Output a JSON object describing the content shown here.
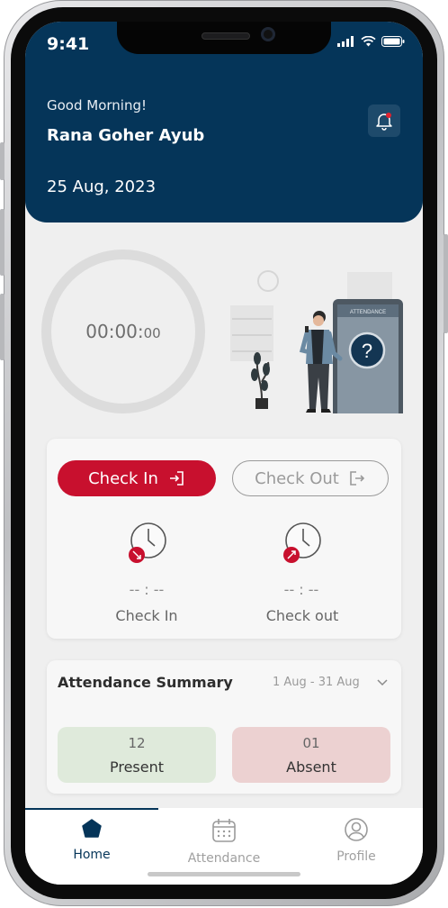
{
  "status_bar": {
    "time": "9:41"
  },
  "header": {
    "greeting": "Good Morning!",
    "user_name": "Rana Goher Ayub",
    "date": "25 Aug, 2023"
  },
  "timer": {
    "main": "00:00:",
    "seconds": "00"
  },
  "illustration": {
    "phone_header": "ATTENDANCE",
    "symbol": "?"
  },
  "actions": {
    "check_in_label": "Check In",
    "check_out_label": "Check Out",
    "check_in_time": "-- : --",
    "check_out_time": "-- : --",
    "check_in_caption": "Check In",
    "check_out_caption": "Check out"
  },
  "summary": {
    "title": "Attendance Summary",
    "range": "1 Aug - 31 Aug",
    "present_count": "12",
    "present_label": "Present",
    "absent_count": "01",
    "absent_label": "Absent"
  },
  "tabs": [
    {
      "label": "Home",
      "icon": "home-icon",
      "active": true
    },
    {
      "label": "Attendance",
      "icon": "calendar-icon",
      "active": false
    },
    {
      "label": "Profile",
      "icon": "profile-icon",
      "active": false
    }
  ],
  "colors": {
    "primary": "#053559",
    "accent": "#c8102e",
    "present_bg": "#dfeadb",
    "absent_bg": "#ecd1d1"
  }
}
